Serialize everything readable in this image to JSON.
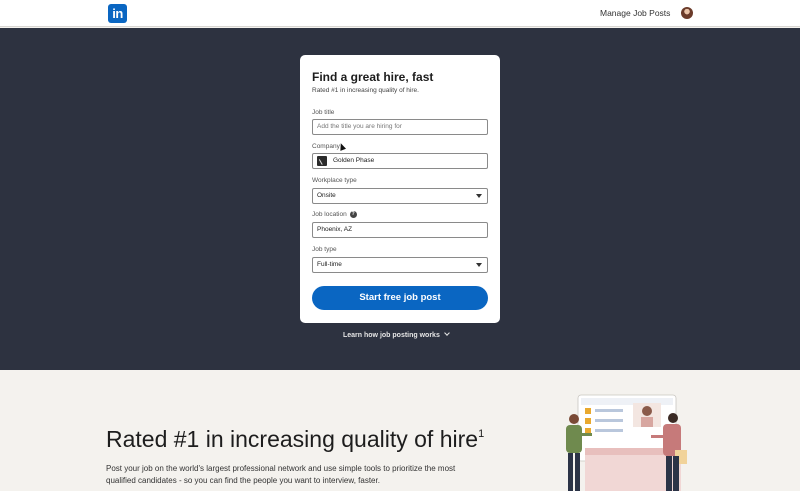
{
  "header": {
    "logo_text": "in",
    "manage_link": "Manage Job Posts"
  },
  "form": {
    "title": "Find a great hire, fast",
    "subtitle": "Rated #1 in increasing quality of hire.",
    "job_title": {
      "label": "Job title",
      "placeholder": "Add the title you are hiring for"
    },
    "company": {
      "label": "Company",
      "value": "Golden Phase"
    },
    "workplace_type": {
      "label": "Workplace type",
      "value": "Onsite"
    },
    "job_location": {
      "label": "Job location",
      "value": "Phoenix, AZ"
    },
    "job_type": {
      "label": "Job type",
      "value": "Full-time"
    },
    "submit_label": "Start free job post"
  },
  "learn_link": "Learn how job posting works",
  "promo": {
    "heading": "Rated #1 in increasing quality of hire",
    "footnote": "1",
    "description": "Post your job on the world's largest professional network and use simple tools to prioritize the most qualified candidates - so you can find the people you want to interview, faster."
  },
  "colors": {
    "brand": "#0a66c2",
    "hero_bg": "#2d3240",
    "page_bg": "#f4f2ee"
  }
}
